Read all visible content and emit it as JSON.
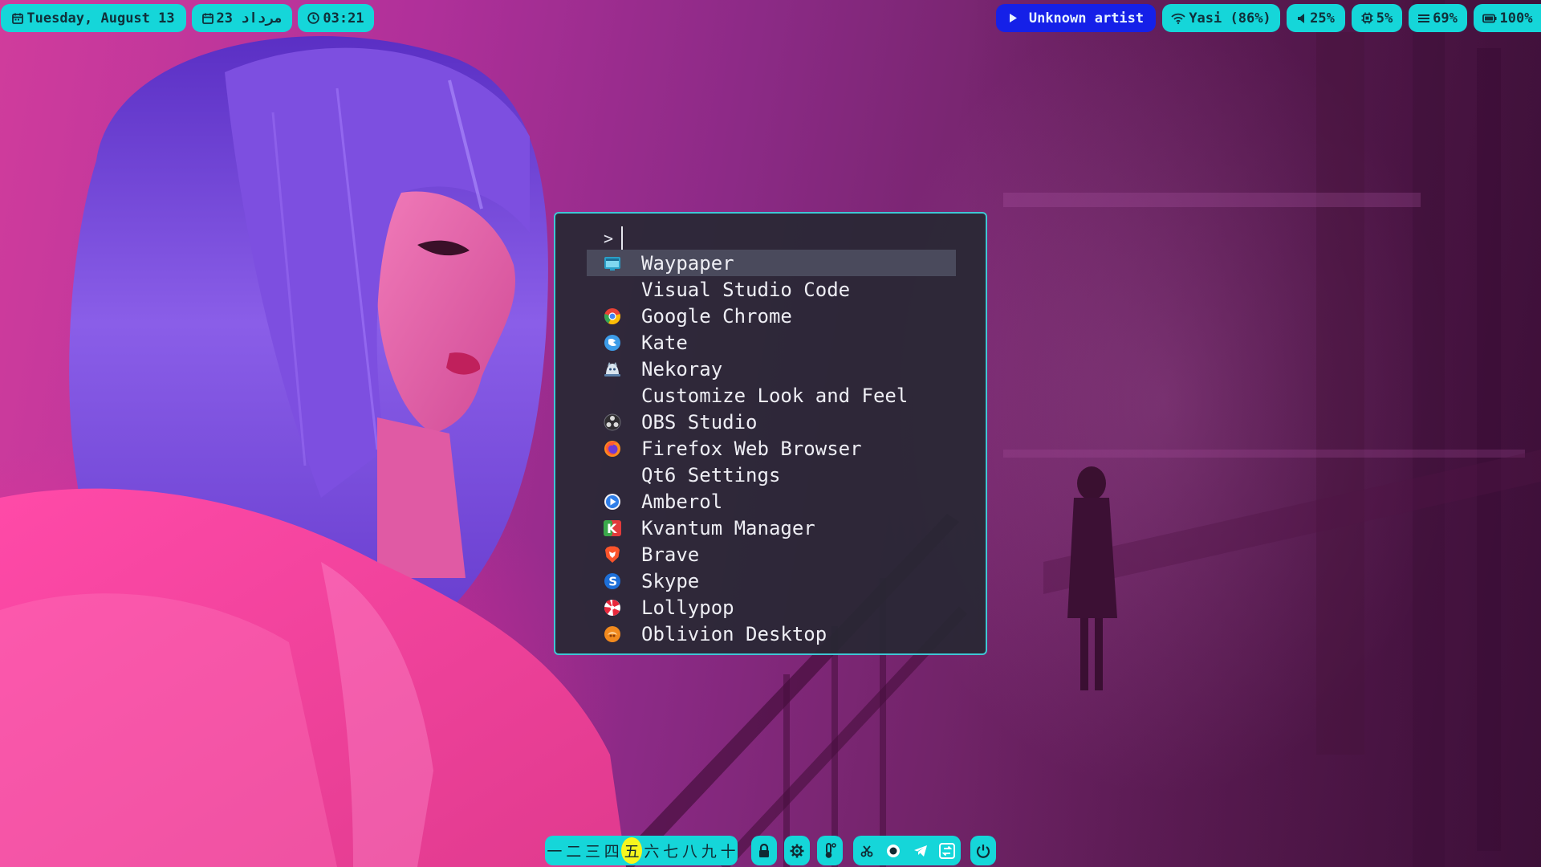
{
  "topbar": {
    "date": "Tuesday, August 13",
    "persian_date": "23 مرداد",
    "time": "03:21",
    "media": "Unknown artist",
    "wifi": "Yasi (86%)",
    "volume": "25%",
    "cpu": "5%",
    "memory": "69%",
    "battery": "100%"
  },
  "launcher": {
    "prompt": ">",
    "search_value": "",
    "items": [
      {
        "label": "Waypaper",
        "icon": "waypaper-icon"
      },
      {
        "label": "Visual Studio Code",
        "icon": ""
      },
      {
        "label": "Google Chrome",
        "icon": "chrome-icon"
      },
      {
        "label": "Kate",
        "icon": "kate-icon"
      },
      {
        "label": "Nekoray",
        "icon": "nekoray-icon"
      },
      {
        "label": "Customize Look and Feel",
        "icon": ""
      },
      {
        "label": "OBS Studio",
        "icon": "obs-icon"
      },
      {
        "label": "Firefox Web Browser",
        "icon": "firefox-icon"
      },
      {
        "label": "Qt6 Settings",
        "icon": ""
      },
      {
        "label": "Amberol",
        "icon": "amberol-icon"
      },
      {
        "label": "Kvantum Manager",
        "icon": "kvantum-icon"
      },
      {
        "label": "Brave",
        "icon": "brave-icon"
      },
      {
        "label": "Skype",
        "icon": "skype-icon"
      },
      {
        "label": "Lollypop",
        "icon": "lollypop-icon"
      },
      {
        "label": "Oblivion Desktop",
        "icon": "oblivion-icon"
      }
    ],
    "selected_index": 0
  },
  "dock": {
    "workspaces": [
      "一",
      "二",
      "三",
      "四",
      "五",
      "六",
      "七",
      "八",
      "九",
      "十"
    ],
    "active_workspace": 4
  },
  "colors": {
    "bar_accent": "#15d6d9",
    "media_pill": "#1520e8",
    "active_workspace": "#f6f61e",
    "launcher_border": "#3fc6d4",
    "launcher_bg": "#282834",
    "selected_row": "#4a4a5c"
  }
}
